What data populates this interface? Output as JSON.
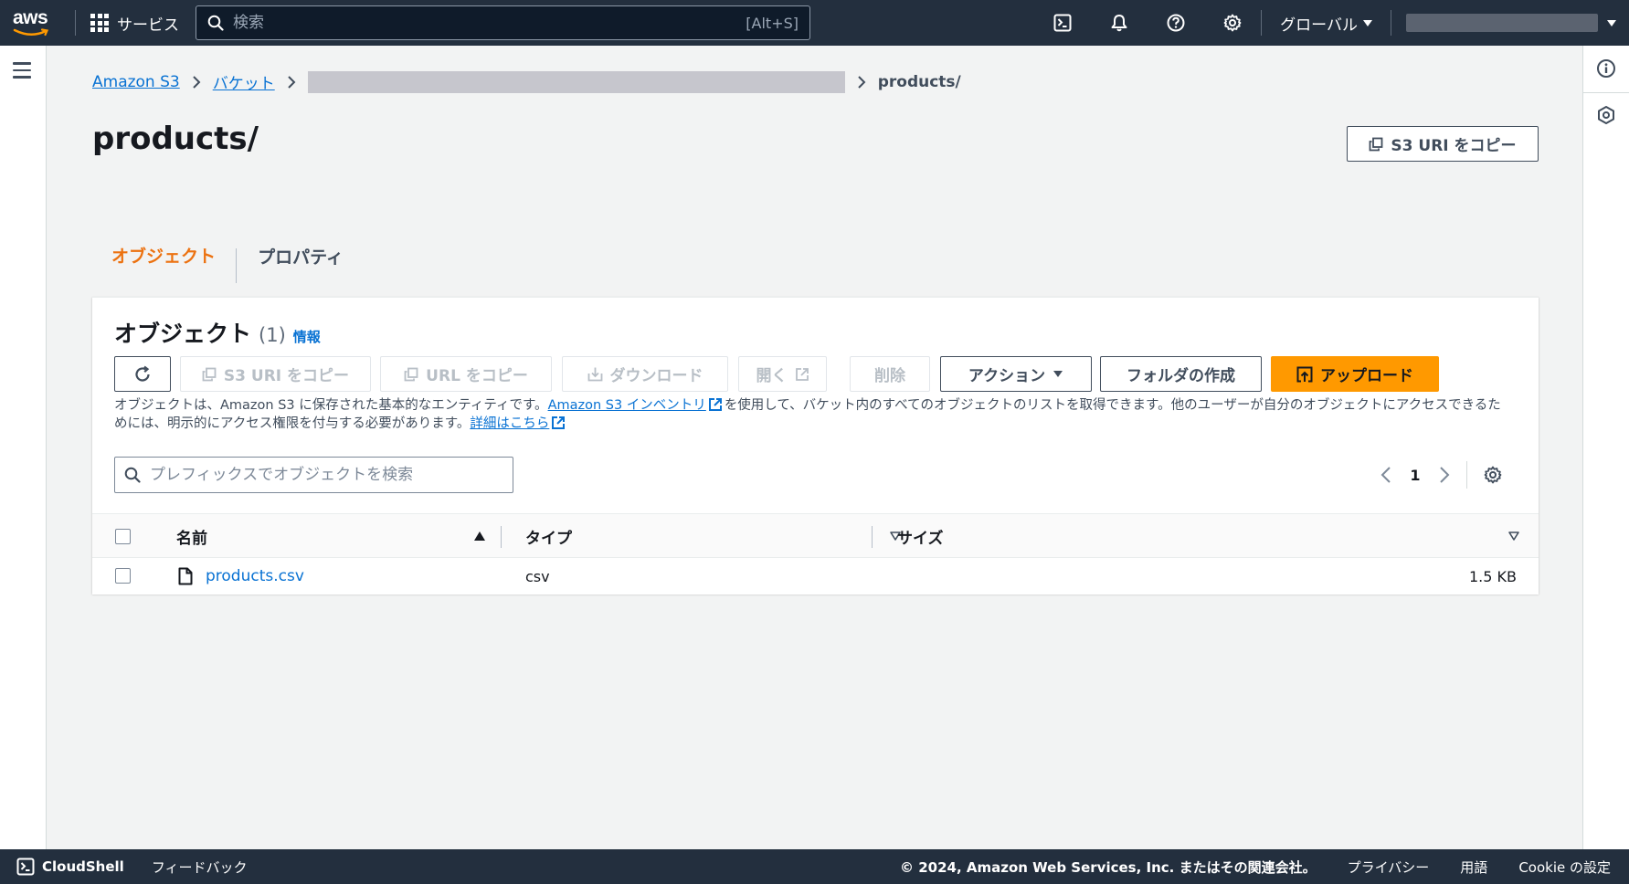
{
  "topnav": {
    "logo_text": "aws",
    "services_label": "サービス",
    "search_placeholder": "検索",
    "search_shortcut": "[Alt+S]",
    "region_label": "グローバル",
    "icons": [
      "cloudshell-icon",
      "notifications-icon",
      "help-icon",
      "settings-icon"
    ]
  },
  "breadcrumb": {
    "items": [
      {
        "label": "Amazon S3"
      },
      {
        "label": "バケット"
      }
    ],
    "current": "products/"
  },
  "page": {
    "title": "products/",
    "copy_uri_label": "S3 URI をコピー"
  },
  "tabs": [
    {
      "label": "オブジェクト",
      "active": true
    },
    {
      "label": "プロパティ",
      "active": false
    }
  ],
  "objects_panel": {
    "title": "オブジェクト",
    "count": "(1)",
    "info_label": "情報",
    "toolbar": {
      "copy_s3_uri": "S3 URI をコピー",
      "copy_url": "URL をコピー",
      "download": "ダウンロード",
      "open": "開く",
      "delete": "削除",
      "actions": "アクション",
      "create_folder": "フォルダの作成",
      "upload": "アップロード"
    },
    "description": {
      "part1": "オブジェクトは、Amazon S3 に保存された基本的なエンティティです。",
      "link1": "Amazon S3 インベントリ",
      "part2": "を使用して、バケット内のすべてのオブジェクトのリストを取得できます。他のユーザーが自分のオブジェクトにアクセスできるためには、明示的にアクセス権限を付与する必要があります。",
      "link2": "詳細はこちら"
    },
    "filter_placeholder": "プレフィックスでオブジェクトを検索",
    "pagination": {
      "current_page": "1"
    },
    "columns": {
      "name": "名前",
      "type": "タイプ",
      "size": "サイズ"
    },
    "rows": [
      {
        "name": "products.csv",
        "type": "csv",
        "size": "1.5 KB"
      }
    ]
  },
  "footer": {
    "cloudshell": "CloudShell",
    "feedback": "フィードバック",
    "copyright": "© 2024, Amazon Web Services, Inc. またはその関連会社。",
    "privacy": "プライバシー",
    "terms": "用語",
    "cookie": "Cookie の設定"
  },
  "colors": {
    "nav_bg": "#232f3e",
    "link": "#0972d3",
    "accent_orange": "#ec7211",
    "primary_button": "#ff9900"
  }
}
